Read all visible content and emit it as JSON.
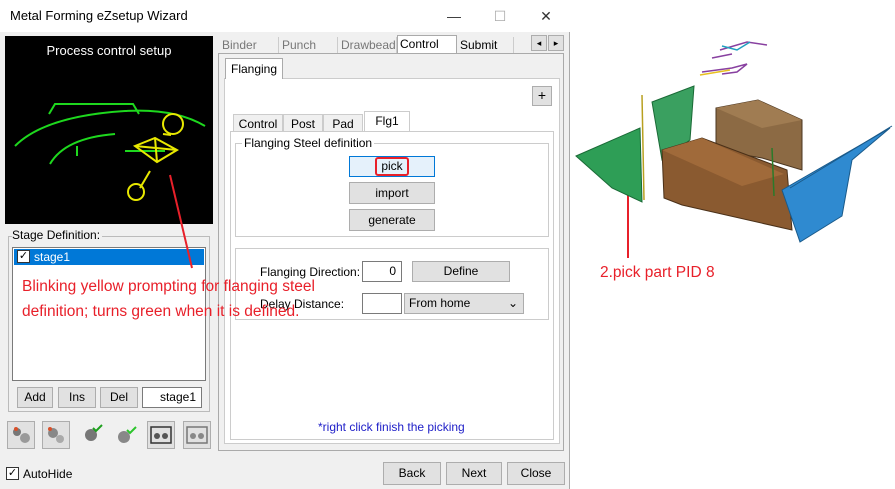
{
  "window": {
    "title": "Metal Forming eZsetup Wizard",
    "minimize": "—",
    "maximize": "☐",
    "close": "✕"
  },
  "preview": {
    "title": "Process control setup"
  },
  "stage": {
    "group_label": "Stage Definition:",
    "items": [
      {
        "label": "stage1",
        "checked": true
      }
    ],
    "buttons": {
      "add": "Add",
      "ins": "Ins",
      "del": "Del"
    },
    "name_value": "stage1"
  },
  "tabs": [
    "Binder",
    "Punch",
    "Drawbead",
    "Control",
    "Submit"
  ],
  "active_tab": "Control",
  "flanging_tab": "Flanging",
  "plus": "+",
  "subtabs": [
    "Control",
    "Post",
    "Pad",
    "Flg1"
  ],
  "active_subtab": "Flg1",
  "steel_def": {
    "legend": "Flanging Steel definition",
    "step": "1",
    "pick": "pick",
    "import": "import",
    "generate": "generate"
  },
  "direction": {
    "label": "Flanging Direction:",
    "value": "0",
    "define": "Define"
  },
  "delay": {
    "label": "Delay Distance:",
    "value": "",
    "option": "From home"
  },
  "hint": "*right click finish the picking",
  "footer": {
    "autohide": "AutoHide",
    "back": "Back",
    "next": "Next",
    "close": "Close"
  },
  "annotations": {
    "note1": "Blinking yellow prompting for flanging steel definition; turns green when it is defined.",
    "note2": "2.pick part PID 8"
  },
  "colors": {
    "accent_red": "#e8202a",
    "selection_blue": "#0078d7",
    "hint_blue": "#2020c8"
  }
}
